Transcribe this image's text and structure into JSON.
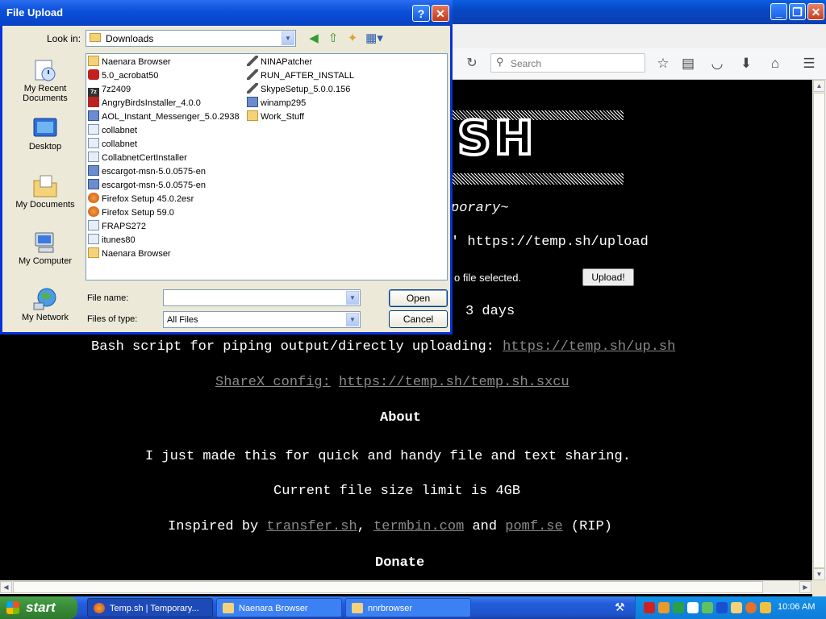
{
  "browser": {
    "search_placeholder": "Search",
    "page": {
      "logo_text": "SH",
      "subtitle": "porary~",
      "curl_line": "' https://temp.sh/upload",
      "no_file_text": "o file selected.",
      "upload_button": "Upload!",
      "expiry_line": "3 days",
      "bash_text": "Bash script for piping output/directly uploading: ",
      "bash_link": "https://temp.sh/up.sh",
      "sharex_label": "ShareX config:",
      "sharex_link": "https://temp.sh/temp.sh.sxcu",
      "about_heading": "About",
      "about_text": "I just made this for quick and handy file and text sharing.",
      "limit_text": "Current file size limit is 4GB",
      "inspired_prefix": "Inspired by ",
      "inspired_link1": "transfer.sh",
      "inspired_sep1": ", ",
      "inspired_link2": "termbin.com",
      "inspired_sep2": " and ",
      "inspired_link3": "pomf.se",
      "inspired_suffix": " (RIP)",
      "donate_heading": "Donate"
    }
  },
  "dialog": {
    "title": "File Upload",
    "help_label": "?",
    "close_label": "✕",
    "look_in_label": "Look in:",
    "look_in_value": "Downloads",
    "places": [
      {
        "label": "My Recent Documents"
      },
      {
        "label": "Desktop"
      },
      {
        "label": "My Documents"
      },
      {
        "label": "My Computer"
      },
      {
        "label": "My Network"
      }
    ],
    "files_col1": [
      "Naenara Browser",
      "5.0_acrobat50",
      "7z2409",
      "AngryBirdsInstaller_4.0.0",
      "AOL_Instant_Messenger_5.0.2938",
      "collabnet",
      "collabnet",
      "CollabnetCertInstaller",
      "escargot-msn-5.0.0575-en",
      "escargot-msn-5.0.0575-en",
      "Firefox Setup 45.0.2esr",
      "Firefox Setup 59.0",
      "FRAPS272",
      "itunes80",
      "Naenara Browser"
    ],
    "files_col2": [
      "NINAPatcher",
      "RUN_AFTER_INSTALL",
      "SkypeSetup_5.0.0.156",
      "winamp295",
      "Work_Stuff"
    ],
    "file_name_label": "File name:",
    "file_name_value": "",
    "files_of_type_label": "Files of type:",
    "files_of_type_value": "All Files",
    "open_button": "Open",
    "cancel_button": "Cancel"
  },
  "taskbar": {
    "start_label": "start",
    "tasks": [
      {
        "label": "Temp.sh | Temporary..."
      },
      {
        "label": "Naenara Browser"
      },
      {
        "label": "nnrbrowser"
      }
    ],
    "clock": "10:06 AM"
  }
}
